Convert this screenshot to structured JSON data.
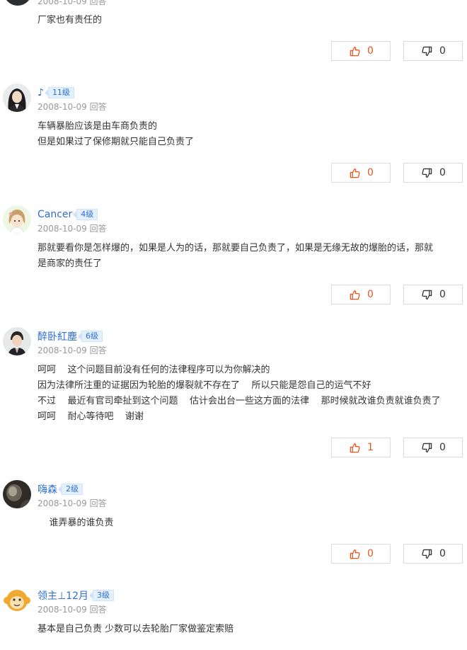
{
  "colors": {
    "link": "#2b6dd1",
    "like": "#e8541e",
    "meta": "#999999",
    "text": "#333333",
    "border": "#dcdcdc"
  },
  "top_partial": {
    "meta": "2008-10-09 回答",
    "text": "厂家也有责任的",
    "likes": "0",
    "dislikes": "0"
  },
  "answers": [
    {
      "username": "♪",
      "level": "11级",
      "date": "2008-10-09",
      "answer_label": "回答",
      "text": "车辆暴胎应该是由车商负责的\n但是如果过了保修期就只能自己负责了",
      "likes": "0",
      "dislikes": "0",
      "avatar_icon": "woman-black-hair-avatar"
    },
    {
      "username": "Cancer",
      "level": "4级",
      "date": "2008-10-09",
      "answer_label": "回答",
      "text": "那就要看你是怎样爆的，如果是人为的话，那就要自己负责了，如果是无缘无故的爆胎的话，那就\n是商家的责任了",
      "likes": "0",
      "dislikes": "0",
      "avatar_icon": "cartoon-girl-avatar"
    },
    {
      "username": "醉卧紅塵",
      "level": "6级",
      "date": "2008-10-09",
      "answer_label": "回答",
      "text": "呵呵    这个问题目前没有任何的法律程序可以为你解决的\n因为法律所注重的证据因为轮胎的爆裂就不存在了    所以只能是怨自己的运气不好\n不过    最近有官司牵扯到这个问题    估计会出台一些这方面的法律    那时候就改谁负责就谁负责了\n呵呵    耐心等待吧    谢谢",
      "likes": "1",
      "dislikes": "0",
      "avatar_icon": "man-in-suit-avatar"
    },
    {
      "username": "嗨森",
      "level": "2级",
      "date": "2008-10-09",
      "answer_label": "回答",
      "text": "    谁弄暴的谁负责",
      "likes": "0",
      "dislikes": "0",
      "avatar_icon": "dark-photo-avatar"
    },
    {
      "username": "领主⊥12月",
      "level": "3级",
      "date": "2008-10-09",
      "answer_label": "回答",
      "text": "基本是自己负责 少数可以去轮胎厂家做鉴定索赔",
      "likes": null,
      "dislikes": null,
      "avatar_icon": "monkey-avatar"
    }
  ]
}
